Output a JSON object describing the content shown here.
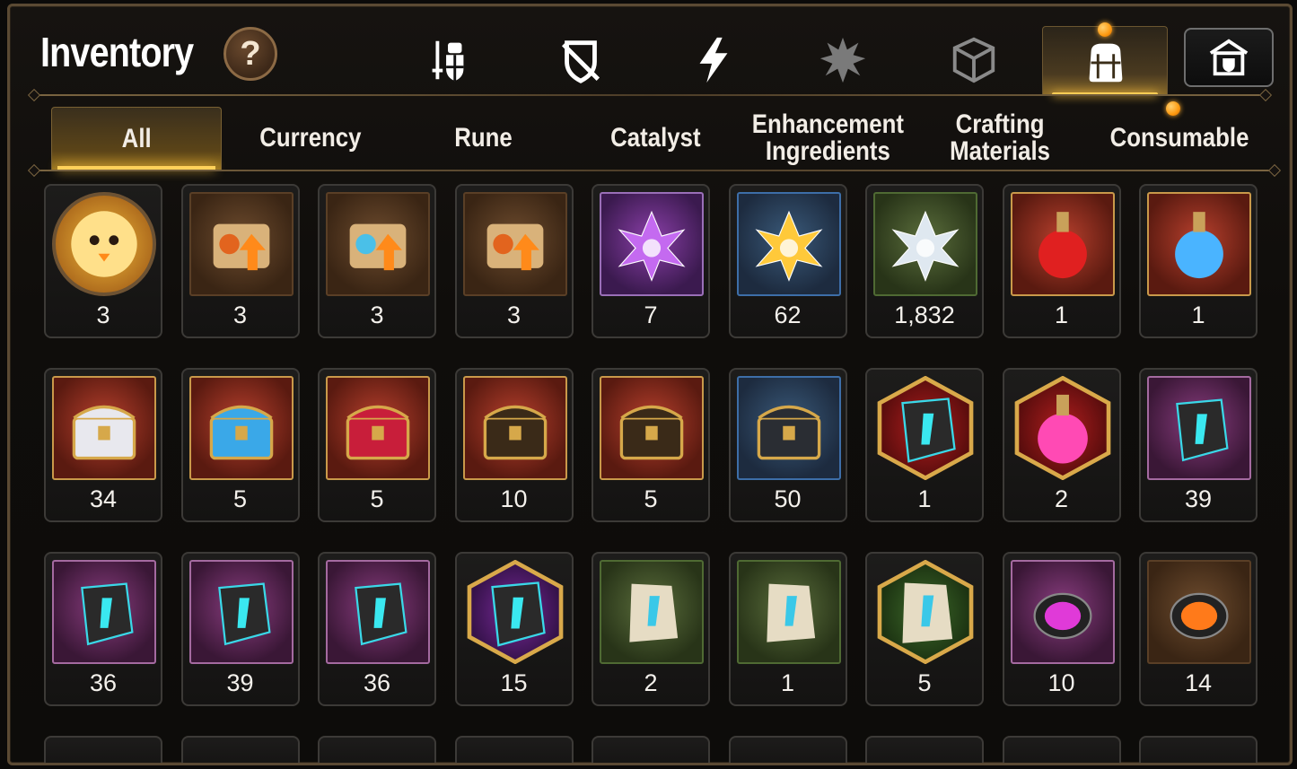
{
  "header": {
    "title": "Inventory",
    "help_label": "?",
    "icon_tabs": [
      {
        "name": "hero-gear-tab",
        "icon": "sword-shield-icon",
        "active": false
      },
      {
        "name": "disabled-gear-tab",
        "icon": "crossed-shield-icon",
        "active": false
      },
      {
        "name": "skill-tab",
        "icon": "lightning-icon",
        "active": false
      },
      {
        "name": "burst-tab",
        "icon": "burst-figure-icon",
        "active": false
      },
      {
        "name": "dice-tab",
        "icon": "dice-icon",
        "active": false
      },
      {
        "name": "bag-tab",
        "icon": "backpack-icon",
        "active": true
      }
    ],
    "guild_button_icon": "guild-shop-icon"
  },
  "categories": [
    {
      "label": "All",
      "active": true
    },
    {
      "label": "Currency",
      "active": false
    },
    {
      "label": "Rune",
      "active": false
    },
    {
      "label": "Catalyst",
      "active": false
    },
    {
      "label": "Enhancement\nIngredients",
      "active": false
    },
    {
      "label": "Crafting\nMaterials",
      "active": false
    },
    {
      "label": "Consumable",
      "active": false
    }
  ],
  "items": [
    {
      "icon": "chick-portrait-icon",
      "bg": "round",
      "count": "3"
    },
    {
      "icon": "fire-scroll-upgrade-icon",
      "bg": "brown",
      "count": "3"
    },
    {
      "icon": "rainbow-scroll-upgrade-icon",
      "bg": "brown",
      "count": "3"
    },
    {
      "icon": "scroll-upgrade-icon",
      "bg": "brown",
      "count": "3"
    },
    {
      "icon": "purple-crystal-flower-icon",
      "bg": "purple",
      "count": "7"
    },
    {
      "icon": "gold-crystal-flower-icon",
      "bg": "blue",
      "count": "62"
    },
    {
      "icon": "silver-crystal-flower-icon",
      "bg": "green",
      "count": "1,832"
    },
    {
      "icon": "red-potion-icon",
      "bg": "red",
      "count": "1"
    },
    {
      "icon": "star-potion-icon",
      "bg": "red",
      "count": "1"
    },
    {
      "icon": "white-chest-icon",
      "bg": "red",
      "count": "34"
    },
    {
      "icon": "blue-chest-icon",
      "bg": "red",
      "count": "5"
    },
    {
      "icon": "red-box-icon",
      "bg": "red",
      "count": "5"
    },
    {
      "icon": "dark-treasure-chest-icon",
      "bg": "red",
      "count": "10"
    },
    {
      "icon": "dark-treasure-chest-icon",
      "bg": "red",
      "count": "5"
    },
    {
      "icon": "silver-box-icon",
      "bg": "blue",
      "count": "50"
    },
    {
      "icon": "red-rune-hex-icon",
      "bg": "hex-red",
      "count": "1"
    },
    {
      "icon": "pink-potion-hex-icon",
      "bg": "hex-red",
      "count": "2"
    },
    {
      "icon": "sword-rune-stone-icon",
      "bg": "violet",
      "count": "39"
    },
    {
      "icon": "helmet-rune-stone-icon",
      "bg": "violet",
      "count": "36"
    },
    {
      "icon": "armor-rune-stone-icon",
      "bg": "violet",
      "count": "39"
    },
    {
      "icon": "boot-rune-stone-icon",
      "bg": "violet",
      "count": "36"
    },
    {
      "icon": "star-rune-hex-icon",
      "bg": "hex-purple",
      "count": "15"
    },
    {
      "icon": "sword-rune-tablet-icon",
      "bg": "green",
      "count": "2"
    },
    {
      "icon": "armor-rune-tablet-icon",
      "bg": "green",
      "count": "1"
    },
    {
      "icon": "star-rune-tablet-hex-icon",
      "bg": "hex-green",
      "count": "5"
    },
    {
      "icon": "purple-gem-icon",
      "bg": "violet",
      "count": "10"
    },
    {
      "icon": "orange-gem-icon",
      "bg": "brown",
      "count": "14"
    }
  ],
  "colors": {
    "accent": "#ffcd55",
    "frame": "#5b4a33",
    "notification": "#ff9a10"
  }
}
